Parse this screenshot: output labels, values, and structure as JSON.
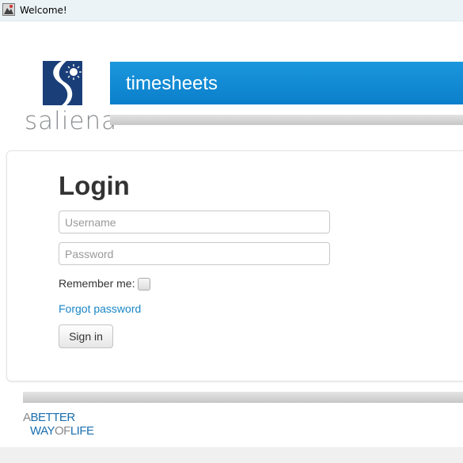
{
  "window": {
    "title": "Welcome!",
    "icon": "app-icon"
  },
  "brand": {
    "logo_text": "saliena",
    "banner_title": "timesheets",
    "colors": {
      "banner": "#0b7fcb",
      "logo_blue": "#1a3e78",
      "link": "#1a86c6"
    }
  },
  "login": {
    "heading": "Login",
    "username_placeholder": "Username",
    "password_placeholder": "Password",
    "remember_label": "Remember me:",
    "remember_checked": false,
    "forgot_label": "Forgot password",
    "signin_label": "Sign in"
  },
  "footer": {
    "tagline_line1_a": "A",
    "tagline_line1_b": "BETTER",
    "tagline_line2_a": "WAY",
    "tagline_line2_b": "OF",
    "tagline_line2_c": "LIFE"
  }
}
